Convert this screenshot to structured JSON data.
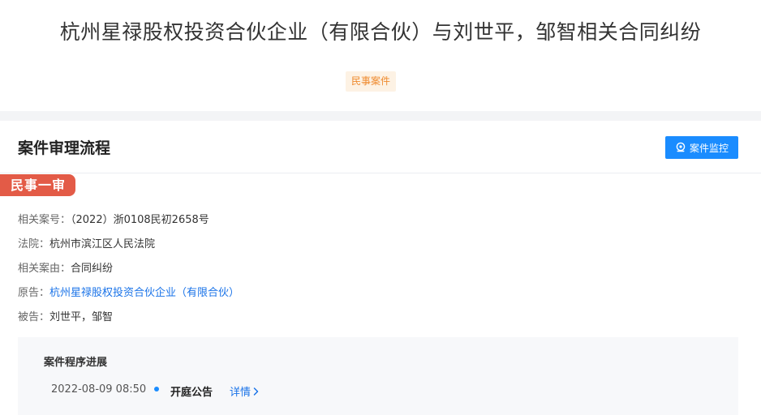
{
  "header": {
    "title": "杭州星禄股权投资合伙企业（有限合伙）与刘世平，邹智相关合同纠纷",
    "tag": "民事案件"
  },
  "process": {
    "section_title": "案件审理流程",
    "monitor_button": "案件监控",
    "stage": "民事一审",
    "fields": {
      "case_no": {
        "label": "相关案号：",
        "value": "（2022）浙0108民初2658号"
      },
      "court": {
        "label": "法院：",
        "value": "杭州市滨江区人民法院"
      },
      "cause": {
        "label": "相关案由：",
        "value": "合同纠纷"
      },
      "plaintiff": {
        "label": "原告：",
        "value": "杭州星禄股权投资合伙企业（有限合伙）"
      },
      "defendant": {
        "label": "被告：",
        "value": "刘世平，邹智"
      }
    },
    "progress": {
      "title": "案件程序进展",
      "events": [
        {
          "date": "2022-08-09 08:50",
          "name": "开庭公告",
          "detail": "详情"
        }
      ]
    }
  },
  "colors": {
    "accent": "#1a8cff",
    "stage_badge": "#e35b47",
    "tag_text": "#ef8a2e",
    "tag_bg": "#fdf2e4"
  },
  "icons": {
    "monitor": "location-pin-icon",
    "detail": "chevron-right-icon"
  }
}
